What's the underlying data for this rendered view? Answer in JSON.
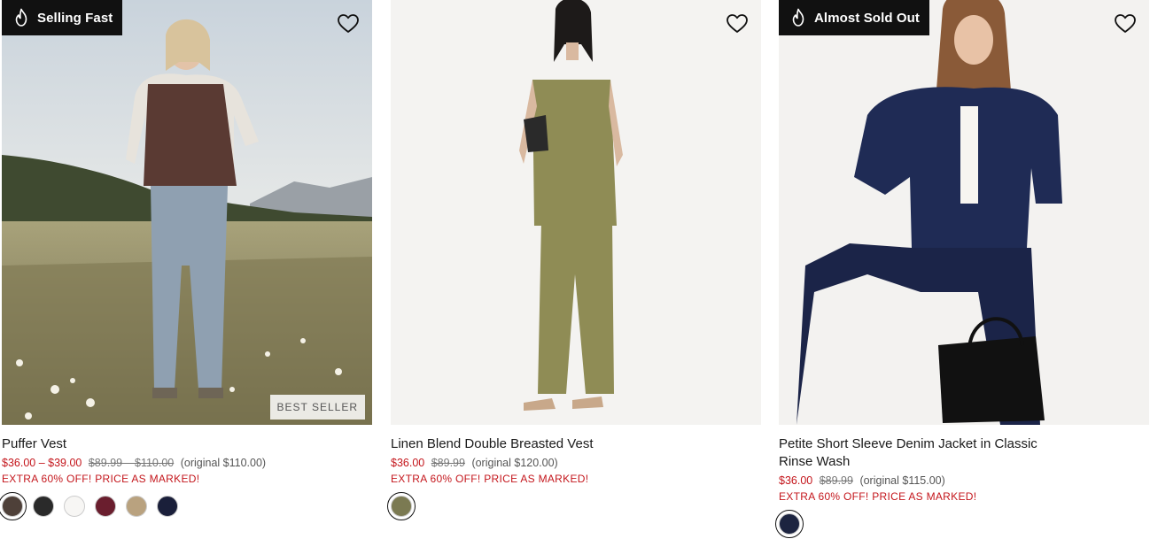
{
  "products": [
    {
      "badge": "Selling Fast",
      "name": "Puffer Vest",
      "price_sale": "$36.00 – $39.00",
      "price_was": "$89.99 – $110.00",
      "price_original": "(original $110.00)",
      "promo": "EXTRA 60% OFF! PRICE AS MARKED!",
      "tag": "BEST SELLER",
      "swatches": [
        "#4e4039",
        "#2a2a2a",
        "#f7f6f4",
        "#6a1e2e",
        "#b9a27f",
        "#1a1f3a"
      ]
    },
    {
      "badge": "",
      "name": "Linen Blend Double Breasted Vest",
      "price_sale": "$36.00",
      "price_was": "$89.99",
      "price_original": "(original $120.00)",
      "promo": "EXTRA 60% OFF! PRICE AS MARKED!",
      "swatches": [
        "#7b7a52"
      ]
    },
    {
      "badge": "Almost Sold Out",
      "name": "Petite Short Sleeve Denim Jacket in Classic Rinse Wash",
      "price_sale": "$36.00",
      "price_was": "$89.99",
      "price_original": "(original $115.00)",
      "promo": "EXTRA 60% OFF! PRICE AS MARKED!",
      "swatches": [
        "#1c2440"
      ]
    }
  ]
}
